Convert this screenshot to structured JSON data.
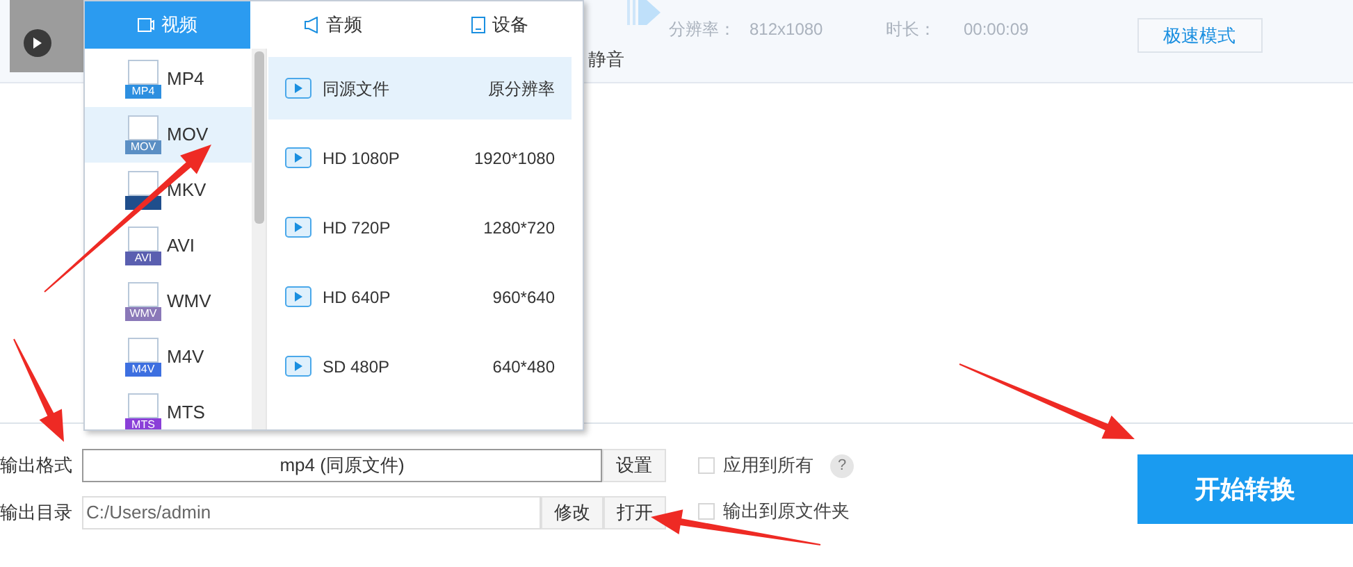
{
  "video_info": {
    "resolution_label": "分辨率：",
    "resolution": "812x1080",
    "duration_label": "时长：",
    "duration": "00:00:09"
  },
  "mute_label": "静音",
  "fast_mode_button": "极速模式",
  "format_popup": {
    "tabs": [
      {
        "label": "视频",
        "kind": "video",
        "selected": true
      },
      {
        "label": "音频",
        "kind": "audio",
        "selected": false
      },
      {
        "label": "设备",
        "kind": "device",
        "selected": false
      }
    ],
    "formats": [
      {
        "label": "MP4",
        "badge": "MP4",
        "color": "#2d8fe0",
        "selected": false
      },
      {
        "label": "MOV",
        "badge": "MOV",
        "color": "#5b8fc4",
        "selected": true
      },
      {
        "label": "MKV",
        "color": "#1f4e8c",
        "selected": false
      },
      {
        "label": "AVI",
        "badge": "AVI",
        "color": "#5a5fb0",
        "selected": false
      },
      {
        "label": "WMV",
        "badge": "WMV",
        "color": "#8a78b8",
        "selected": false
      },
      {
        "label": "M4V",
        "badge": "M4V",
        "color": "#3d6fe0",
        "selected": false
      },
      {
        "label": "MTS",
        "badge": "MTS",
        "color": "#8a3fd8",
        "selected": false
      }
    ],
    "presets": [
      {
        "name": "同源文件",
        "resolution": "原分辨率",
        "selected": true
      },
      {
        "name": "HD 1080P",
        "resolution": "1920*1080",
        "selected": false
      },
      {
        "name": "HD 720P",
        "resolution": "1280*720",
        "selected": false
      },
      {
        "name": "HD 640P",
        "resolution": "960*640",
        "selected": false
      },
      {
        "name": "SD 480P",
        "resolution": "640*480",
        "selected": false
      }
    ]
  },
  "output_format": {
    "label": "输出格式",
    "value": "mp4 (同原文件)",
    "button": "设置"
  },
  "output_dir": {
    "label": "输出目录",
    "value": "C:/Users/admin",
    "buttons": [
      "修改",
      "打开"
    ]
  },
  "options": [
    {
      "label": "应用到所有",
      "checked": false,
      "help": "?"
    },
    {
      "label": "输出到原文件夹",
      "checked": false
    }
  ],
  "start_button": "开始转换"
}
